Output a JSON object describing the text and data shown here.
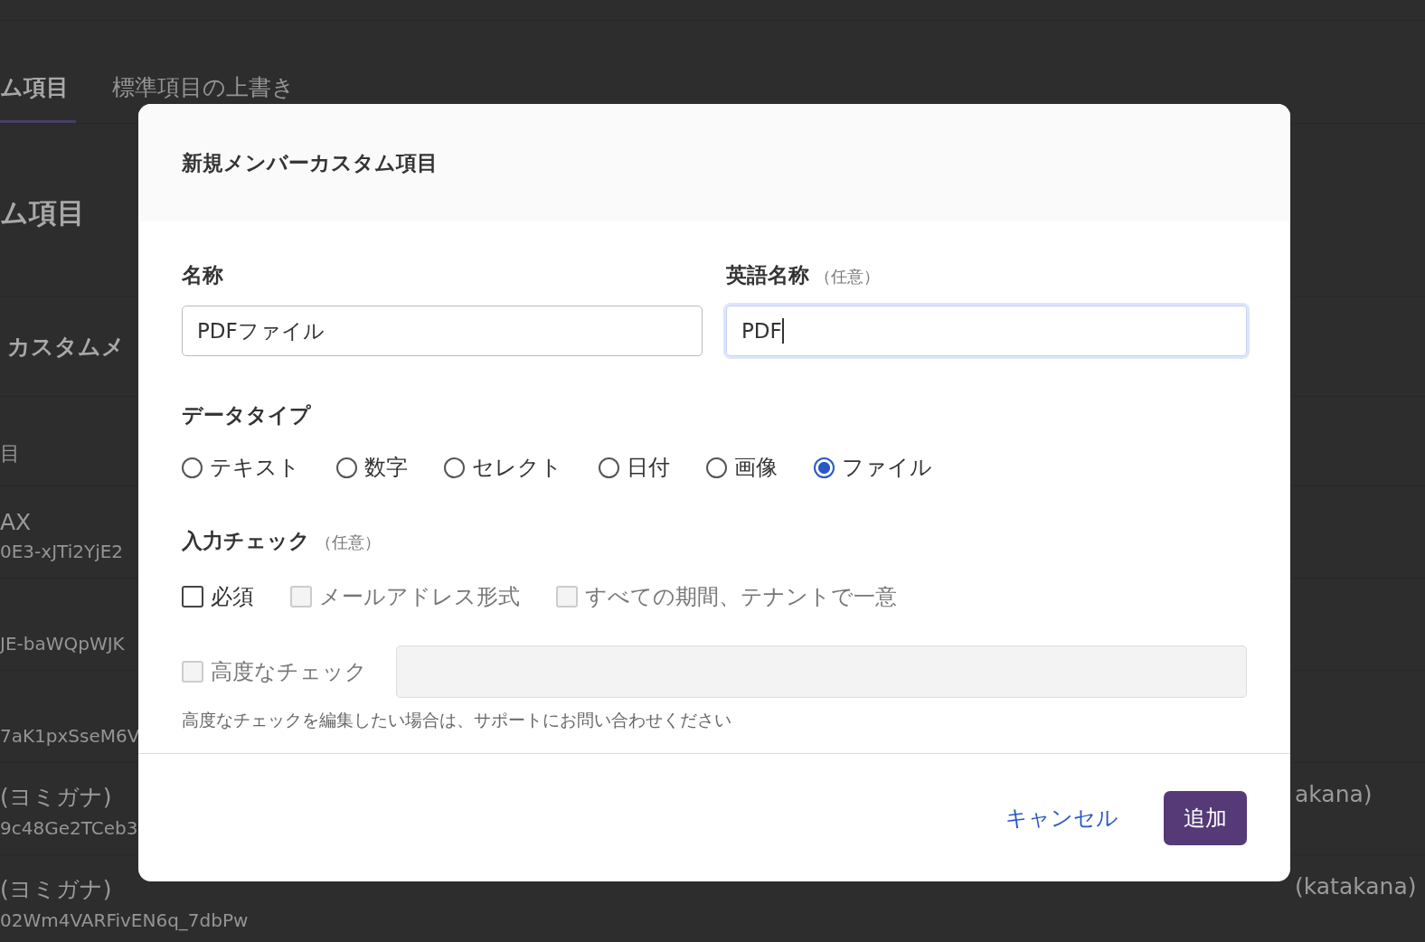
{
  "background": {
    "tabs": [
      {
        "label": "ム項目",
        "selected": true
      },
      {
        "label": "標準項目の上書き",
        "selected": false
      }
    ],
    "heading": "ム項目",
    "section_title": "カスタムメ",
    "column_header": "目",
    "rows": [
      {
        "name": "AX",
        "id": "0E3-xJTi2YjE2"
      },
      {
        "id": "JE-baWQpWJK"
      },
      {
        "id": "7aK1pxSseM6V"
      },
      {
        "name": "(ヨミガナ)",
        "id": "9c48Ge2TCeb3",
        "column_3": "akana)"
      },
      {
        "name": "(ヨミガナ)",
        "id": "02Wm4VARFivEN6q_7dbPw",
        "column_3": "(katakana)"
      }
    ]
  },
  "dialog": {
    "title": "新規メンバーカスタム項目",
    "fields": [
      {
        "label": "名称",
        "value": "PDFファイル",
        "focused": false
      },
      {
        "label": "英語名称",
        "note": "（任意）",
        "value": "PDF",
        "focused": true
      }
    ],
    "data_type": {
      "label": "データタイプ",
      "options": [
        {
          "label": "テキスト",
          "selected": false
        },
        {
          "label": "数字",
          "selected": false
        },
        {
          "label": "セレクト",
          "selected": false
        },
        {
          "label": "日付",
          "selected": false
        },
        {
          "label": "画像",
          "selected": false
        },
        {
          "label": "ファイル",
          "selected": true
        }
      ]
    },
    "input_check": {
      "label": "入力チェック",
      "note": "（任意）",
      "options": [
        {
          "label": "必須",
          "checked": false,
          "disabled": false
        },
        {
          "label": "メールアドレス形式",
          "checked": false,
          "disabled": true
        },
        {
          "label": "すべての期間、テナントで一意",
          "checked": false,
          "disabled": true
        }
      ],
      "advanced": {
        "label": "高度なチェック",
        "checked": false,
        "disabled": true
      },
      "help": "高度なチェックを編集したい場合は、サポートにお問い合わせください"
    },
    "cancel": "キャンセル",
    "submit": "追加"
  }
}
